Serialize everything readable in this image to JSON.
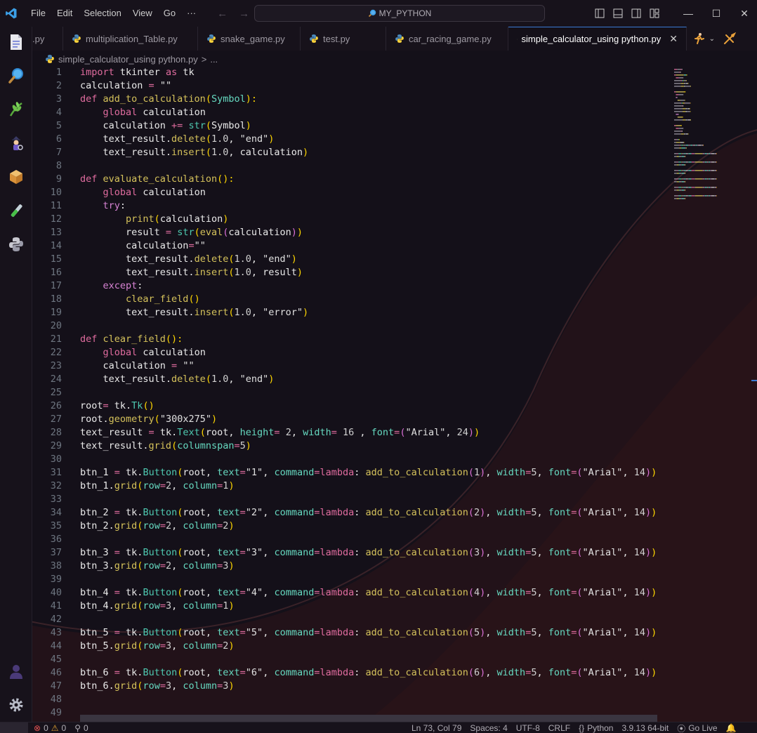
{
  "menu": [
    "File",
    "Edit",
    "Selection",
    "View",
    "Go"
  ],
  "menu_more": "···",
  "search": {
    "label": "MY_PYTHON"
  },
  "window_controls": {
    "minimize": "—",
    "maximize": "☐",
    "close": "✕"
  },
  "tabs": [
    {
      "label": ".py",
      "active": false
    },
    {
      "label": "multiplication_Table.py",
      "active": false
    },
    {
      "label": "snake_game.py",
      "active": false
    },
    {
      "label": "test.py",
      "active": false
    },
    {
      "label": "car_racing_game.py",
      "active": false
    },
    {
      "label": "simple_calculator_using python.py",
      "active": true
    }
  ],
  "tab_close": "✕",
  "breadcrumb": {
    "file": "simple_calculator_using python.py",
    "sep": ">",
    "rest": "..."
  },
  "code_lines": [
    [
      [
        "kw",
        "import "
      ],
      [
        "v",
        "tkinter "
      ],
      [
        "kw",
        "as "
      ],
      [
        "v",
        "tk"
      ]
    ],
    [
      [
        "v",
        "calculation "
      ],
      [
        "op",
        "= "
      ],
      [
        "s",
        "\"\""
      ]
    ],
    [
      [
        "kw",
        "def "
      ],
      [
        "fn",
        "add_to_calculation"
      ],
      [
        "p1",
        "("
      ],
      [
        "pr",
        "Symbol"
      ],
      [
        "p1",
        "):"
      ]
    ],
    [
      [
        "v",
        "    "
      ],
      [
        "kw",
        "global "
      ],
      [
        "v",
        "calculation"
      ]
    ],
    [
      [
        "v",
        "    calculation "
      ],
      [
        "op",
        "+= "
      ],
      [
        "cls",
        "str"
      ],
      [
        "p1",
        "("
      ],
      [
        "v",
        "Symbol"
      ],
      [
        "p1",
        ")"
      ]
    ],
    [
      [
        "v",
        "    text_result."
      ],
      [
        "fn",
        "delete"
      ],
      [
        "p1",
        "("
      ],
      [
        "n",
        "1.0"
      ],
      [
        "v",
        ", "
      ],
      [
        "s",
        "\"end\""
      ],
      [
        "p1",
        ")"
      ]
    ],
    [
      [
        "v",
        "    text_result."
      ],
      [
        "fn",
        "insert"
      ],
      [
        "p1",
        "("
      ],
      [
        "n",
        "1.0"
      ],
      [
        "v",
        ", calculation"
      ],
      [
        "p1",
        ")"
      ]
    ],
    [],
    [
      [
        "kw",
        "def "
      ],
      [
        "fn",
        "evaluate_calculation"
      ],
      [
        "p1",
        "():"
      ]
    ],
    [
      [
        "v",
        "    "
      ],
      [
        "kw",
        "global "
      ],
      [
        "v",
        "calculation"
      ]
    ],
    [
      [
        "v",
        "    "
      ],
      [
        "ctl",
        "try"
      ],
      [
        "v",
        ":"
      ]
    ],
    [
      [
        "v",
        "        "
      ],
      [
        "fn",
        "print"
      ],
      [
        "p1",
        "("
      ],
      [
        "v",
        "calculation"
      ],
      [
        "p1",
        ")"
      ]
    ],
    [
      [
        "v",
        "        result "
      ],
      [
        "op",
        "= "
      ],
      [
        "cls",
        "str"
      ],
      [
        "p1",
        "("
      ],
      [
        "fn",
        "eval"
      ],
      [
        "p2",
        "("
      ],
      [
        "v",
        "calculation"
      ],
      [
        "p2",
        ")"
      ],
      [
        "p1",
        ")"
      ]
    ],
    [
      [
        "v",
        "        calculation"
      ],
      [
        "op",
        "="
      ],
      [
        "s",
        "\"\""
      ]
    ],
    [
      [
        "v",
        "        text_result."
      ],
      [
        "fn",
        "delete"
      ],
      [
        "p1",
        "("
      ],
      [
        "n",
        "1.0"
      ],
      [
        "v",
        ", "
      ],
      [
        "s",
        "\"end\""
      ],
      [
        "p1",
        ")"
      ]
    ],
    [
      [
        "v",
        "        text_result."
      ],
      [
        "fn",
        "insert"
      ],
      [
        "p1",
        "("
      ],
      [
        "n",
        "1.0"
      ],
      [
        "v",
        ", result"
      ],
      [
        "p1",
        ")"
      ]
    ],
    [
      [
        "v",
        "    "
      ],
      [
        "ctl",
        "except"
      ],
      [
        "v",
        ":"
      ]
    ],
    [
      [
        "v",
        "        "
      ],
      [
        "fn",
        "clear_field"
      ],
      [
        "p1",
        "()"
      ]
    ],
    [
      [
        "v",
        "        text_result."
      ],
      [
        "fn",
        "insert"
      ],
      [
        "p1",
        "("
      ],
      [
        "n",
        "1.0"
      ],
      [
        "v",
        ", "
      ],
      [
        "s",
        "\"error\""
      ],
      [
        "p1",
        ")"
      ]
    ],
    [],
    [
      [
        "kw",
        "def "
      ],
      [
        "fn",
        "clear_field"
      ],
      [
        "p1",
        "():"
      ]
    ],
    [
      [
        "v",
        "    "
      ],
      [
        "kw",
        "global "
      ],
      [
        "v",
        "calculation"
      ]
    ],
    [
      [
        "v",
        "    calculation "
      ],
      [
        "op",
        "= "
      ],
      [
        "s",
        "\"\""
      ]
    ],
    [
      [
        "v",
        "    text_result."
      ],
      [
        "fn",
        "delete"
      ],
      [
        "p1",
        "("
      ],
      [
        "n",
        "1.0"
      ],
      [
        "v",
        ", "
      ],
      [
        "s",
        "\"end\""
      ],
      [
        "p1",
        ")"
      ]
    ],
    [],
    [
      [
        "v",
        "root"
      ],
      [
        "op",
        "= "
      ],
      [
        "v",
        "tk."
      ],
      [
        "cls",
        "Tk"
      ],
      [
        "p1",
        "()"
      ]
    ],
    [
      [
        "v",
        "root."
      ],
      [
        "fn",
        "geometry"
      ],
      [
        "p1",
        "("
      ],
      [
        "s",
        "\"300x275\""
      ],
      [
        "p1",
        ")"
      ]
    ],
    [
      [
        "v",
        "text_result "
      ],
      [
        "op",
        "= "
      ],
      [
        "v",
        "tk."
      ],
      [
        "cls",
        "Text"
      ],
      [
        "p1",
        "("
      ],
      [
        "v",
        "root, "
      ],
      [
        "pr",
        "height"
      ],
      [
        "op",
        "= "
      ],
      [
        "n",
        "2"
      ],
      [
        "v",
        ", "
      ],
      [
        "pr",
        "width"
      ],
      [
        "op",
        "= "
      ],
      [
        "n",
        "16 "
      ],
      [
        "v",
        ", "
      ],
      [
        "pr",
        "font"
      ],
      [
        "op",
        "="
      ],
      [
        "p2",
        "("
      ],
      [
        "s",
        "\"Arial\""
      ],
      [
        "v",
        ", "
      ],
      [
        "n",
        "24"
      ],
      [
        "p2",
        ")"
      ],
      [
        "p1",
        ")"
      ]
    ],
    [
      [
        "v",
        "text_result."
      ],
      [
        "fn",
        "grid"
      ],
      [
        "p1",
        "("
      ],
      [
        "pr",
        "columnspan"
      ],
      [
        "op",
        "="
      ],
      [
        "n",
        "5"
      ],
      [
        "p1",
        ")"
      ]
    ],
    [],
    [
      [
        "v",
        "btn_1 "
      ],
      [
        "op",
        "= "
      ],
      [
        "v",
        "tk."
      ],
      [
        "cls",
        "Button"
      ],
      [
        "p1",
        "("
      ],
      [
        "v",
        "root, "
      ],
      [
        "pr",
        "text"
      ],
      [
        "op",
        "="
      ],
      [
        "s",
        "\"1\""
      ],
      [
        "v",
        ", "
      ],
      [
        "pr",
        "command"
      ],
      [
        "op",
        "="
      ],
      [
        "kw",
        "lambda"
      ],
      [
        "v",
        ": "
      ],
      [
        "fn",
        "add_to_calculation"
      ],
      [
        "p2",
        "("
      ],
      [
        "n",
        "1"
      ],
      [
        "p2",
        ")"
      ],
      [
        "v",
        ", "
      ],
      [
        "pr",
        "width"
      ],
      [
        "op",
        "="
      ],
      [
        "n",
        "5"
      ],
      [
        "v",
        ", "
      ],
      [
        "pr",
        "font"
      ],
      [
        "op",
        "="
      ],
      [
        "p2",
        "("
      ],
      [
        "s",
        "\"Arial\""
      ],
      [
        "v",
        ", "
      ],
      [
        "n",
        "14"
      ],
      [
        "p2",
        ")"
      ],
      [
        "p1",
        ")"
      ]
    ],
    [
      [
        "v",
        "btn_1."
      ],
      [
        "fn",
        "grid"
      ],
      [
        "p1",
        "("
      ],
      [
        "pr",
        "row"
      ],
      [
        "op",
        "="
      ],
      [
        "n",
        "2"
      ],
      [
        "v",
        ", "
      ],
      [
        "pr",
        "column"
      ],
      [
        "op",
        "="
      ],
      [
        "n",
        "1"
      ],
      [
        "p1",
        ")"
      ]
    ],
    [],
    [
      [
        "v",
        "btn_2 "
      ],
      [
        "op",
        "= "
      ],
      [
        "v",
        "tk."
      ],
      [
        "cls",
        "Button"
      ],
      [
        "p1",
        "("
      ],
      [
        "v",
        "root, "
      ],
      [
        "pr",
        "text"
      ],
      [
        "op",
        "="
      ],
      [
        "s",
        "\"2\""
      ],
      [
        "v",
        ", "
      ],
      [
        "pr",
        "command"
      ],
      [
        "op",
        "="
      ],
      [
        "kw",
        "lambda"
      ],
      [
        "v",
        ": "
      ],
      [
        "fn",
        "add_to_calculation"
      ],
      [
        "p2",
        "("
      ],
      [
        "n",
        "2"
      ],
      [
        "p2",
        ")"
      ],
      [
        "v",
        ", "
      ],
      [
        "pr",
        "width"
      ],
      [
        "op",
        "="
      ],
      [
        "n",
        "5"
      ],
      [
        "v",
        ", "
      ],
      [
        "pr",
        "font"
      ],
      [
        "op",
        "="
      ],
      [
        "p2",
        "("
      ],
      [
        "s",
        "\"Arial\""
      ],
      [
        "v",
        ", "
      ],
      [
        "n",
        "14"
      ],
      [
        "p2",
        ")"
      ],
      [
        "p1",
        ")"
      ]
    ],
    [
      [
        "v",
        "btn_2."
      ],
      [
        "fn",
        "grid"
      ],
      [
        "p1",
        "("
      ],
      [
        "pr",
        "row"
      ],
      [
        "op",
        "="
      ],
      [
        "n",
        "2"
      ],
      [
        "v",
        ", "
      ],
      [
        "pr",
        "column"
      ],
      [
        "op",
        "="
      ],
      [
        "n",
        "2"
      ],
      [
        "p1",
        ")"
      ]
    ],
    [],
    [
      [
        "v",
        "btn_3 "
      ],
      [
        "op",
        "= "
      ],
      [
        "v",
        "tk."
      ],
      [
        "cls",
        "Button"
      ],
      [
        "p1",
        "("
      ],
      [
        "v",
        "root, "
      ],
      [
        "pr",
        "text"
      ],
      [
        "op",
        "="
      ],
      [
        "s",
        "\"3\""
      ],
      [
        "v",
        ", "
      ],
      [
        "pr",
        "command"
      ],
      [
        "op",
        "="
      ],
      [
        "kw",
        "lambda"
      ],
      [
        "v",
        ": "
      ],
      [
        "fn",
        "add_to_calculation"
      ],
      [
        "p2",
        "("
      ],
      [
        "n",
        "3"
      ],
      [
        "p2",
        ")"
      ],
      [
        "v",
        ", "
      ],
      [
        "pr",
        "width"
      ],
      [
        "op",
        "="
      ],
      [
        "n",
        "5"
      ],
      [
        "v",
        ", "
      ],
      [
        "pr",
        "font"
      ],
      [
        "op",
        "="
      ],
      [
        "p2",
        "("
      ],
      [
        "s",
        "\"Arial\""
      ],
      [
        "v",
        ", "
      ],
      [
        "n",
        "14"
      ],
      [
        "p2",
        ")"
      ],
      [
        "p1",
        ")"
      ]
    ],
    [
      [
        "v",
        "btn_3."
      ],
      [
        "fn",
        "grid"
      ],
      [
        "p1",
        "("
      ],
      [
        "pr",
        "row"
      ],
      [
        "op",
        "="
      ],
      [
        "n",
        "2"
      ],
      [
        "v",
        ", "
      ],
      [
        "pr",
        "column"
      ],
      [
        "op",
        "="
      ],
      [
        "n",
        "3"
      ],
      [
        "p1",
        ")"
      ]
    ],
    [],
    [
      [
        "v",
        "btn_4 "
      ],
      [
        "op",
        "= "
      ],
      [
        "v",
        "tk."
      ],
      [
        "cls",
        "Button"
      ],
      [
        "p1",
        "("
      ],
      [
        "v",
        "root, "
      ],
      [
        "pr",
        "text"
      ],
      [
        "op",
        "="
      ],
      [
        "s",
        "\"4\""
      ],
      [
        "v",
        ", "
      ],
      [
        "pr",
        "command"
      ],
      [
        "op",
        "="
      ],
      [
        "kw",
        "lambda"
      ],
      [
        "v",
        ": "
      ],
      [
        "fn",
        "add_to_calculation"
      ],
      [
        "p2",
        "("
      ],
      [
        "n",
        "4"
      ],
      [
        "p2",
        ")"
      ],
      [
        "v",
        ", "
      ],
      [
        "pr",
        "width"
      ],
      [
        "op",
        "="
      ],
      [
        "n",
        "5"
      ],
      [
        "v",
        ", "
      ],
      [
        "pr",
        "font"
      ],
      [
        "op",
        "="
      ],
      [
        "p2",
        "("
      ],
      [
        "s",
        "\"Arial\""
      ],
      [
        "v",
        ", "
      ],
      [
        "n",
        "14"
      ],
      [
        "p2",
        ")"
      ],
      [
        "p1",
        ")"
      ]
    ],
    [
      [
        "v",
        "btn_4."
      ],
      [
        "fn",
        "grid"
      ],
      [
        "p1",
        "("
      ],
      [
        "pr",
        "row"
      ],
      [
        "op",
        "="
      ],
      [
        "n",
        "3"
      ],
      [
        "v",
        ", "
      ],
      [
        "pr",
        "column"
      ],
      [
        "op",
        "="
      ],
      [
        "n",
        "1"
      ],
      [
        "p1",
        ")"
      ]
    ],
    [],
    [
      [
        "v",
        "btn_5 "
      ],
      [
        "op",
        "= "
      ],
      [
        "v",
        "tk."
      ],
      [
        "cls",
        "Button"
      ],
      [
        "p1",
        "("
      ],
      [
        "v",
        "root, "
      ],
      [
        "pr",
        "text"
      ],
      [
        "op",
        "="
      ],
      [
        "s",
        "\"5\""
      ],
      [
        "v",
        ", "
      ],
      [
        "pr",
        "command"
      ],
      [
        "op",
        "="
      ],
      [
        "kw",
        "lambda"
      ],
      [
        "v",
        ": "
      ],
      [
        "fn",
        "add_to_calculation"
      ],
      [
        "p2",
        "("
      ],
      [
        "n",
        "5"
      ],
      [
        "p2",
        ")"
      ],
      [
        "v",
        ", "
      ],
      [
        "pr",
        "width"
      ],
      [
        "op",
        "="
      ],
      [
        "n",
        "5"
      ],
      [
        "v",
        ", "
      ],
      [
        "pr",
        "font"
      ],
      [
        "op",
        "="
      ],
      [
        "p2",
        "("
      ],
      [
        "s",
        "\"Arial\""
      ],
      [
        "v",
        ", "
      ],
      [
        "n",
        "14"
      ],
      [
        "p2",
        ")"
      ],
      [
        "p1",
        ")"
      ]
    ],
    [
      [
        "v",
        "btn_5."
      ],
      [
        "fn",
        "grid"
      ],
      [
        "p1",
        "("
      ],
      [
        "pr",
        "row"
      ],
      [
        "op",
        "="
      ],
      [
        "n",
        "3"
      ],
      [
        "v",
        ", "
      ],
      [
        "pr",
        "column"
      ],
      [
        "op",
        "="
      ],
      [
        "n",
        "2"
      ],
      [
        "p1",
        ")"
      ]
    ],
    [],
    [
      [
        "v",
        "btn_6 "
      ],
      [
        "op",
        "= "
      ],
      [
        "v",
        "tk."
      ],
      [
        "cls",
        "Button"
      ],
      [
        "p1",
        "("
      ],
      [
        "v",
        "root, "
      ],
      [
        "pr",
        "text"
      ],
      [
        "op",
        "="
      ],
      [
        "s",
        "\"6\""
      ],
      [
        "v",
        ", "
      ],
      [
        "pr",
        "command"
      ],
      [
        "op",
        "="
      ],
      [
        "kw",
        "lambda"
      ],
      [
        "v",
        ": "
      ],
      [
        "fn",
        "add_to_calculation"
      ],
      [
        "p2",
        "("
      ],
      [
        "n",
        "6"
      ],
      [
        "p2",
        ")"
      ],
      [
        "v",
        ", "
      ],
      [
        "pr",
        "width"
      ],
      [
        "op",
        "="
      ],
      [
        "n",
        "5"
      ],
      [
        "v",
        ", "
      ],
      [
        "pr",
        "font"
      ],
      [
        "op",
        "="
      ],
      [
        "p2",
        "("
      ],
      [
        "s",
        "\"Arial\""
      ],
      [
        "v",
        ", "
      ],
      [
        "n",
        "14"
      ],
      [
        "p2",
        ")"
      ],
      [
        "p1",
        ")"
      ]
    ],
    [
      [
        "v",
        "btn_6."
      ],
      [
        "fn",
        "grid"
      ],
      [
        "p1",
        "("
      ],
      [
        "pr",
        "row"
      ],
      [
        "op",
        "="
      ],
      [
        "n",
        "3"
      ],
      [
        "v",
        ", "
      ],
      [
        "pr",
        "column"
      ],
      [
        "op",
        "="
      ],
      [
        "n",
        "3"
      ],
      [
        "p1",
        ")"
      ]
    ],
    [],
    []
  ],
  "status": {
    "errors": "0",
    "warnings": "0",
    "ports": "0",
    "position": "Ln 73, Col 79",
    "spaces": "Spaces: 4",
    "encoding": "UTF-8",
    "eol": "CRLF",
    "language": "Python",
    "interpreter": "3.9.13 64-bit",
    "golive": "Go Live"
  },
  "colors": {
    "accent": "#3a7bd5",
    "background": "#141019",
    "chrome": "#17121b"
  },
  "icons": [
    "vscode-logo-icon",
    "explorer-icon",
    "search-icon",
    "source-control-icon",
    "run-debug-icon",
    "extensions-icon",
    "testing-icon",
    "python-icon",
    "account-icon",
    "settings-gear-icon"
  ]
}
